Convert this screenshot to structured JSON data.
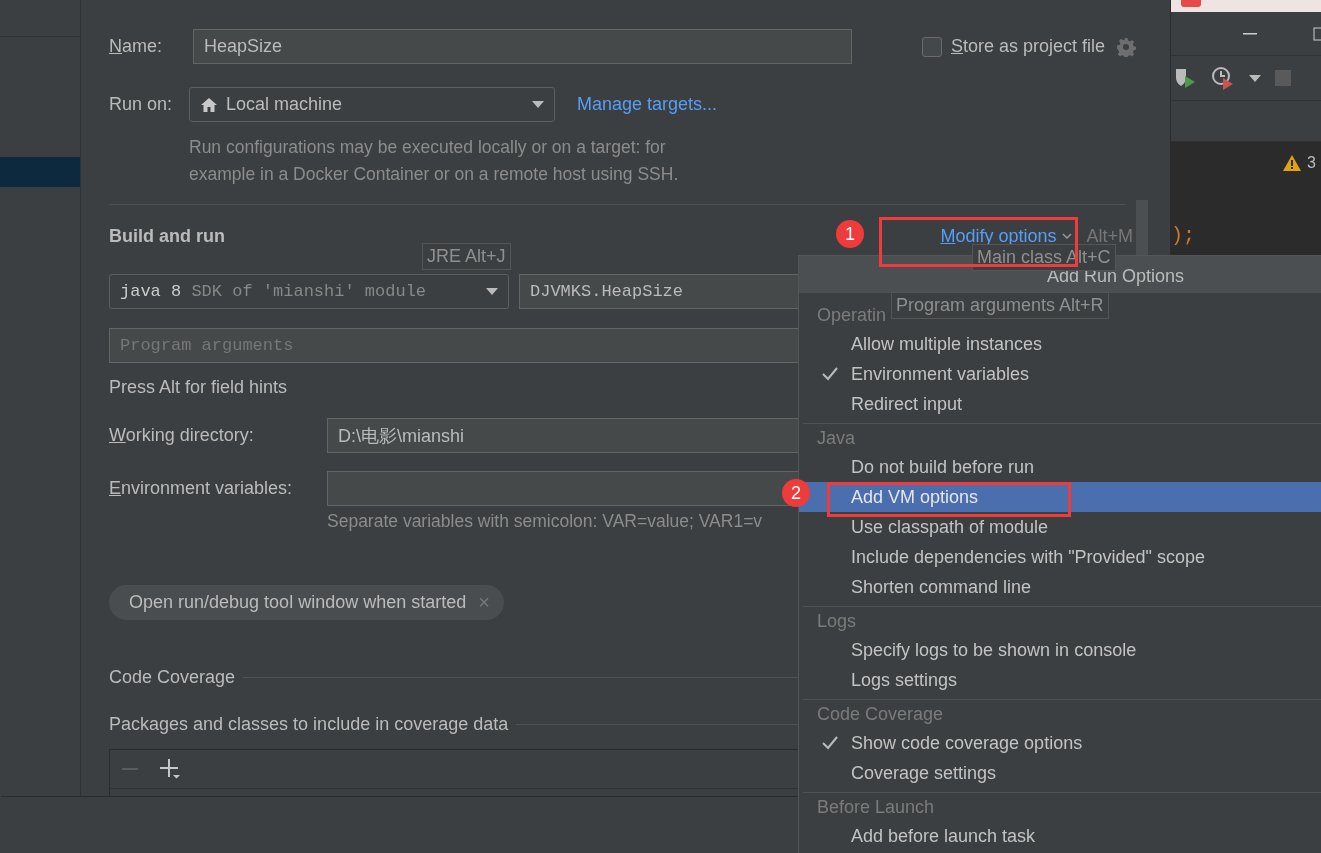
{
  "form": {
    "name": {
      "label": "Name:",
      "value": "HeapSize"
    },
    "store_as_project_file": {
      "label": "Store as project file",
      "checked": false
    },
    "run_on": {
      "label": "Run on:",
      "value": "Local machine"
    },
    "manage_targets": "Manage targets...",
    "run_on_hint": "Run configurations may be executed locally or on a target: for example in a Docker Container or on a remote host using SSH.",
    "section_title": "Build and run",
    "modify_options": {
      "label": "Modify options",
      "shortcut": "Alt+M"
    },
    "jre": {
      "version": "java 8",
      "detail": "SDK of 'mianshi' module"
    },
    "main_class": "DJVMKS.HeapSize",
    "program_arguments": {
      "placeholder": "Program arguments"
    },
    "field_hint": "Press Alt for field hints",
    "working_directory": {
      "label": "Working directory:",
      "value": "D:\\电影\\mianshi"
    },
    "environment_variables": {
      "label": "Environment variables:",
      "hint": "Separate variables with semicolon: VAR=value; VAR1=v"
    },
    "chip": {
      "label": "Open run/debug tool window when started",
      "close": "×"
    },
    "code_coverage": "Code Coverage",
    "packages": "Packages and classes to include in coverage data"
  },
  "tooltips": [
    {
      "kind": "jre",
      "text": "JRE Alt+J"
    },
    {
      "kind": "main",
      "text": "Main class Alt+C"
    },
    {
      "kind": "args",
      "text": "Program arguments Alt+R"
    }
  ],
  "popup": {
    "title": "Add Run Options",
    "groups": [
      {
        "title": "Operatin",
        "items": [
          {
            "label": "Allow multiple instances",
            "checked": false,
            "selected": false
          },
          {
            "label": "Environment variables",
            "checked": true,
            "selected": false
          },
          {
            "label": "Redirect input",
            "checked": false,
            "selected": false
          }
        ]
      },
      {
        "title": "Java",
        "items": [
          {
            "label": "Do not build before run",
            "checked": false,
            "selected": false
          },
          {
            "label": "Add VM options",
            "checked": false,
            "selected": true
          },
          {
            "label": "Use classpath of module",
            "checked": false,
            "selected": false
          },
          {
            "label": "Include dependencies with \"Provided\" scope",
            "checked": false,
            "selected": false
          },
          {
            "label": "Shorten command line",
            "checked": false,
            "selected": false
          }
        ]
      },
      {
        "title": "Logs",
        "items": [
          {
            "label": "Specify logs to be shown in console",
            "checked": false,
            "selected": false
          },
          {
            "label": "Logs settings",
            "checked": false,
            "selected": false
          }
        ]
      },
      {
        "title": "Code Coverage",
        "items": [
          {
            "label": "Show code coverage options",
            "checked": true,
            "selected": false
          },
          {
            "label": "Coverage settings",
            "checked": false,
            "selected": false
          }
        ]
      },
      {
        "title": "Before Launch",
        "items": [
          {
            "label": "Add before launch task",
            "checked": false,
            "selected": false
          }
        ]
      }
    ]
  },
  "annotations": [
    {
      "kind": "modify",
      "number": "1"
    },
    {
      "kind": "vm",
      "number": "2"
    }
  ],
  "editor": {
    "warning_count": "3",
    "code": ");"
  }
}
